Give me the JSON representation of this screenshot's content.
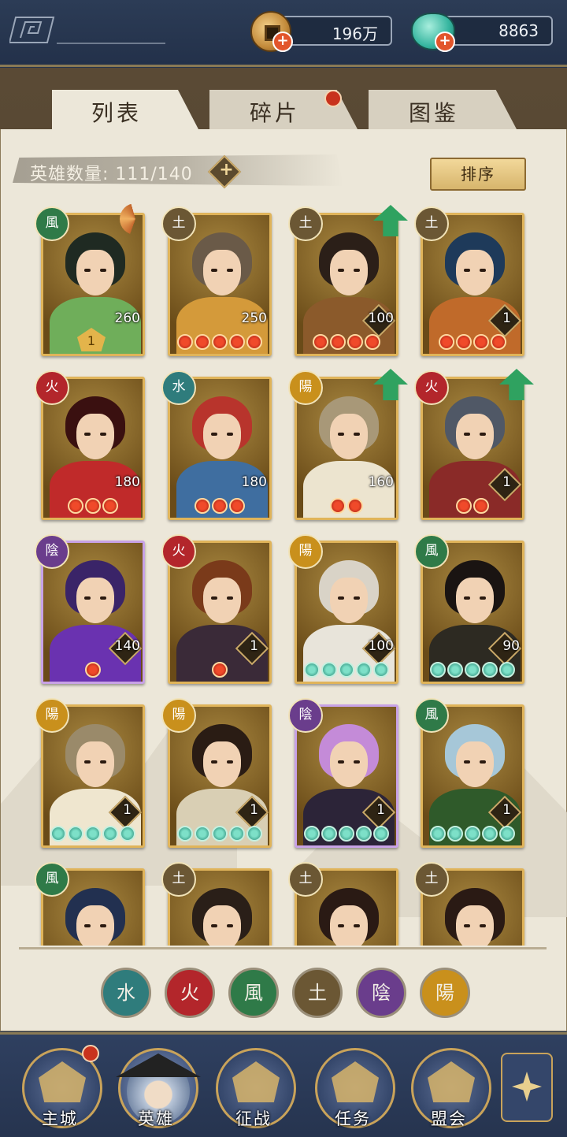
{
  "currency": {
    "coins": "196万",
    "jade": "8863"
  },
  "tabs": [
    {
      "label": "列表",
      "active": true
    },
    {
      "label": "碎片",
      "active": false,
      "notification": true
    },
    {
      "label": "图鉴",
      "active": false
    }
  ],
  "hero_count": "英雄数量: 111/140",
  "sort_label": "排序",
  "heroes": [
    {
      "element": "風",
      "level": "260",
      "stars": 0,
      "star_color": "red"
    },
    {
      "element": "土",
      "level": "250",
      "stars": 5,
      "star_color": "red"
    },
    {
      "element": "土",
      "level": "100",
      "stars": 4,
      "star_color": "red",
      "upgrade": true
    },
    {
      "element": "土",
      "level": "1",
      "stars": 4,
      "star_color": "red"
    },
    {
      "element": "火",
      "level": "180",
      "stars": 3,
      "star_color": "red"
    },
    {
      "element": "水",
      "level": "180",
      "stars": 3,
      "star_color": "red"
    },
    {
      "element": "陽",
      "level": "160",
      "stars": 2,
      "star_color": "red",
      "upgrade": true
    },
    {
      "element": "火",
      "level": "1",
      "stars": 2,
      "star_color": "red",
      "upgrade": true
    },
    {
      "element": "陰",
      "level": "140",
      "stars": 1,
      "star_color": "red"
    },
    {
      "element": "火",
      "level": "1",
      "stars": 1,
      "star_color": "red"
    },
    {
      "element": "陽",
      "level": "100",
      "stars": 5,
      "star_color": "jade"
    },
    {
      "element": "風",
      "level": "90",
      "stars": 5,
      "star_color": "jade"
    },
    {
      "element": "陽",
      "level": "1",
      "stars": 5,
      "star_color": "jade"
    },
    {
      "element": "陽",
      "level": "1",
      "stars": 5,
      "star_color": "jade"
    },
    {
      "element": "陰",
      "level": "1",
      "stars": 5,
      "star_color": "jade"
    },
    {
      "element": "風",
      "level": "1",
      "stars": 5,
      "star_color": "jade"
    },
    {
      "element": "風",
      "level": "",
      "stars": 0,
      "star_color": "red"
    },
    {
      "element": "土",
      "level": "",
      "stars": 0,
      "star_color": "red"
    },
    {
      "element": "土",
      "level": "",
      "stars": 0,
      "star_color": "red"
    },
    {
      "element": "土",
      "level": "",
      "stars": 0,
      "star_color": "red"
    }
  ],
  "first_card_badge": "1",
  "element_filters": [
    "水",
    "火",
    "風",
    "土",
    "陰",
    "陽"
  ],
  "nav": [
    {
      "label": "主城",
      "notification": true
    },
    {
      "label": "英雄",
      "active": true
    },
    {
      "label": "征战"
    },
    {
      "label": "任务"
    },
    {
      "label": "盟会"
    }
  ],
  "colors": {
    "water": "#2f7c7c",
    "fire": "#b3262b",
    "wind": "#2f7a48",
    "earth": "#6b5734",
    "yin": "#6a3d8c",
    "yang": "#c9901c"
  }
}
